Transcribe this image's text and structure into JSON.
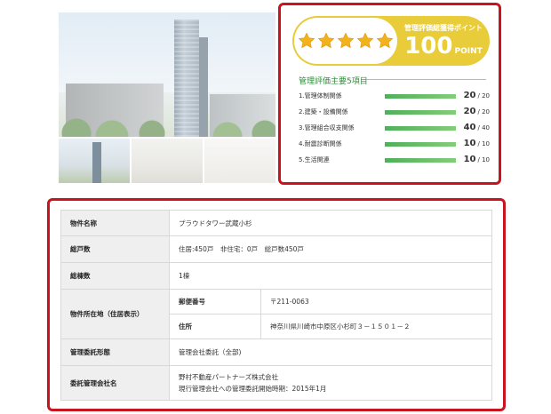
{
  "rating": {
    "stars": 5,
    "points_label": "管理評価総獲得ポイント",
    "points_value": "100",
    "points_unit": "POINT",
    "items_title": "管理評価主要5項目",
    "items": [
      {
        "label": "1.管理体制関係",
        "score": "20",
        "max": "/ 20",
        "fraction": 1.0
      },
      {
        "label": "2.建築・設備関係",
        "score": "20",
        "max": "/ 20",
        "fraction": 1.0
      },
      {
        "label": "3.管理組合収支関係",
        "score": "40",
        "max": "/ 40",
        "fraction": 1.0
      },
      {
        "label": "4.耐震診断関係",
        "score": "10",
        "max": "/ 10",
        "fraction": 1.0
      },
      {
        "label": "5.生活関連",
        "score": "10",
        "max": "/ 10",
        "fraction": 1.0
      }
    ],
    "colors": {
      "border": "#c8141e",
      "pill": "#e8cc3a",
      "star": "#f2b21c",
      "bar": "#4fb05a",
      "title": "#2e8b3a"
    }
  },
  "property": {
    "name_label": "物件名称",
    "name_value": "プラウドタワー武蔵小杉",
    "units_label": "総戸数",
    "units_value": "住居:450戸　非住宅：0戸　総戸数450戸",
    "buildings_label": "総棟数",
    "buildings_value": "1棟",
    "address_label": "物件所在地（住居表示）",
    "postal_label": "郵便番号",
    "postal_value": "〒211-0063",
    "addr_label": "住所",
    "addr_value": "神奈川県川崎市中原区小杉町３－１５０１－２",
    "mgmt_type_label": "管理委託形態",
    "mgmt_type_value": "管理会社委託（全部)",
    "company_label": "委託管理会社名",
    "company_value_1": "野村不動産パートナーズ株式会社",
    "company_value_2": "現行管理会社への管理委託開始時期：2015年1月"
  }
}
